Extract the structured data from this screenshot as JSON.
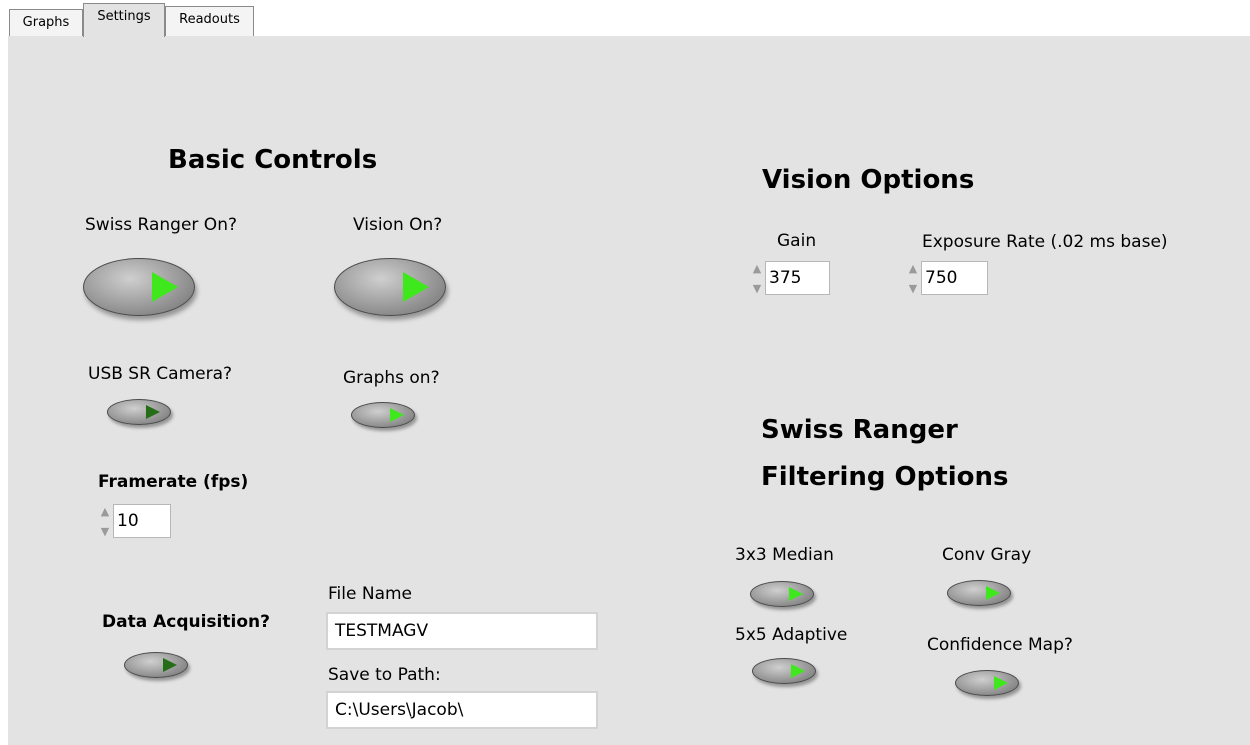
{
  "tabs": [
    {
      "label": "Graphs",
      "active": false
    },
    {
      "label": "Settings",
      "active": true
    },
    {
      "label": "Readouts",
      "active": false
    }
  ],
  "basic_controls": {
    "title": "Basic Controls",
    "swiss_ranger_on": {
      "label": "Swiss Ranger On?",
      "state": "on"
    },
    "vision_on": {
      "label": "Vision On?",
      "state": "on"
    },
    "usb_sr_camera": {
      "label": "USB SR Camera?",
      "state": "off"
    },
    "graphs_on": {
      "label": "Graphs on?",
      "state": "on"
    },
    "framerate": {
      "label": "Framerate (fps)",
      "value": "10"
    },
    "data_acquisition": {
      "label": "Data Acquisition?",
      "state": "off"
    },
    "file_name": {
      "label": "File Name",
      "value": "TESTMAGV"
    },
    "save_path": {
      "label": "Save to Path:",
      "value": "C:\\Users\\Jacob\\"
    }
  },
  "vision_options": {
    "title": "Vision Options",
    "gain": {
      "label": "Gain",
      "value": "375"
    },
    "exposure": {
      "label": "Exposure Rate (.02 ms base)",
      "value": "750"
    }
  },
  "filtering_options": {
    "title_line1": "Swiss Ranger",
    "title_line2": "Filtering Options",
    "median_3x3": {
      "label": "3x3 Median",
      "state": "on"
    },
    "conv_gray": {
      "label": "Conv Gray",
      "state": "on"
    },
    "adaptive_5x5": {
      "label": "5x5 Adaptive",
      "state": "on"
    },
    "confidence_map": {
      "label": "Confidence Map?",
      "state": "on"
    }
  },
  "icons": {
    "button_indicator": "play-triangle-icon",
    "spin_up": "arrow-up-icon",
    "spin_down": "arrow-down-icon"
  },
  "colors": {
    "panel_bg": "#e3e3e3",
    "led_on": "#3ee81c",
    "led_off": "#256d17"
  }
}
